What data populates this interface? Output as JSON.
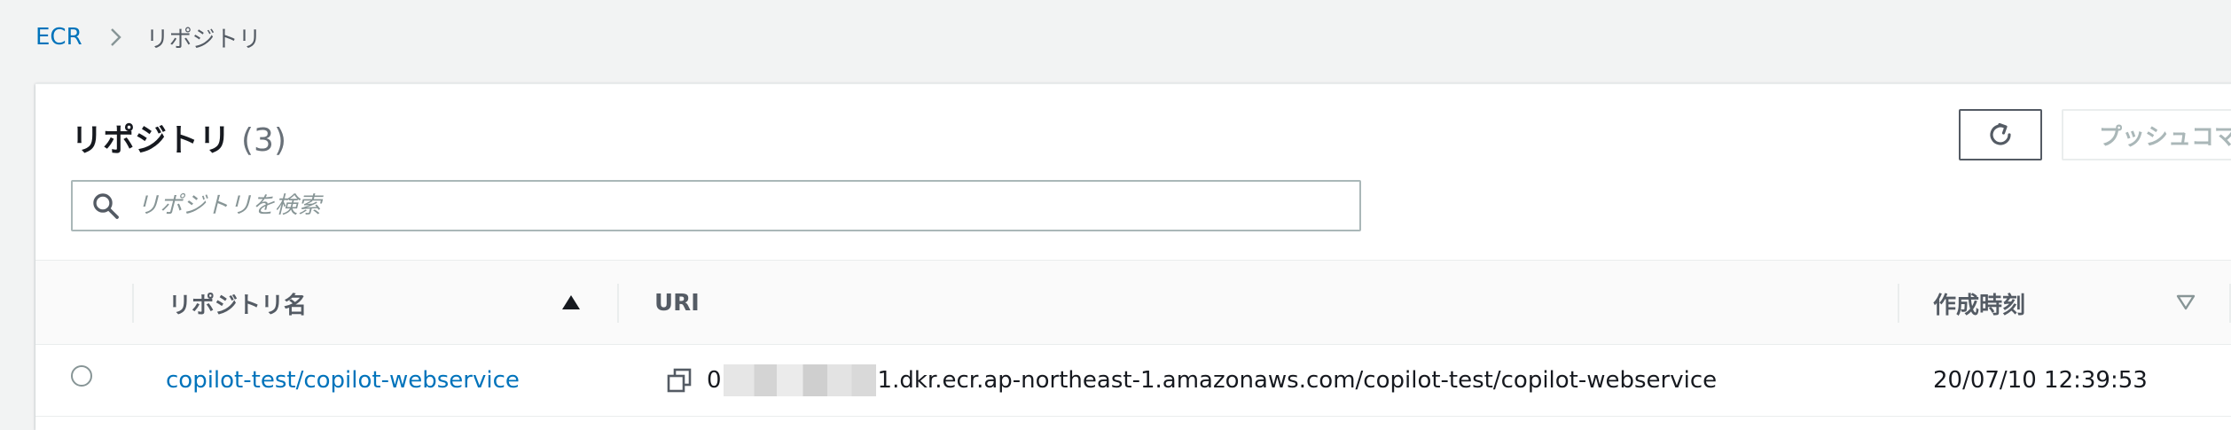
{
  "breadcrumb": {
    "root": "ECR",
    "current": "リポジトリ"
  },
  "panel": {
    "title": "リポジトリ",
    "count": "(3)",
    "push_button_label": "プッシュコマ"
  },
  "search": {
    "placeholder": "リポジトリを検索",
    "value": ""
  },
  "table": {
    "columns": [
      {
        "label": "リポジトリ名",
        "sort": "ascending"
      },
      {
        "label": "URI"
      },
      {
        "label": "作成時刻",
        "sort": "unsorted"
      }
    ],
    "rows": [
      {
        "name": "copilot-test/copilot-webservice",
        "uri_prefix": "0",
        "uri_suffix": "1.dkr.ecr.ap-northeast-1.amazonaws.com/copilot-test/copilot-webservice",
        "created": "20/07/10 12:39:53",
        "selected": false
      }
    ]
  },
  "colors": {
    "link": "#0073bb",
    "background": "#f2f3f3",
    "header_text": "#545b64",
    "border": "#eaeded"
  },
  "icons": [
    "chevron-right-icon",
    "refresh-icon",
    "search-icon",
    "sort-ascending-icon",
    "sort-descending-icon",
    "copy-icon"
  ]
}
